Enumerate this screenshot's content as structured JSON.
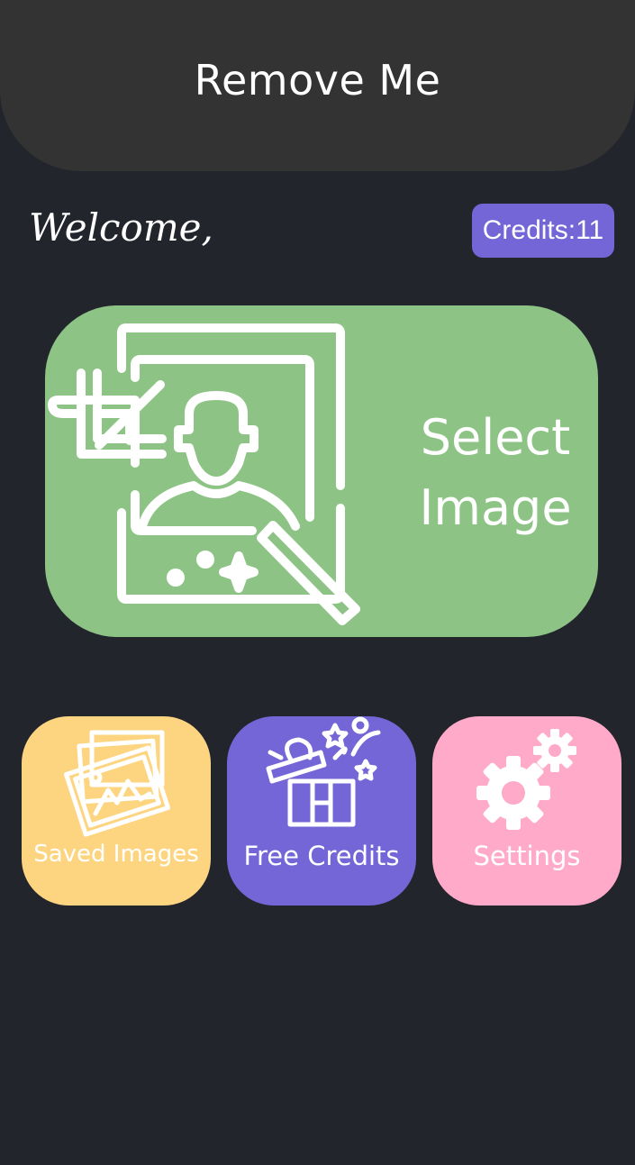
{
  "header": {
    "title": "Remove Me"
  },
  "welcome": {
    "text": "Welcome,"
  },
  "credits": {
    "label": "Credits:11"
  },
  "select_card": {
    "line1": "Select",
    "line2": "Image",
    "icon": "photo-edit-icon"
  },
  "tiles": [
    {
      "label": "Saved Images",
      "icon": "images-icon"
    },
    {
      "label": "Free Credits",
      "icon": "gift-icon"
    },
    {
      "label": "Settings",
      "icon": "gears-icon"
    }
  ],
  "colors": {
    "background": "#23252d",
    "header": "#333333",
    "accent_purple": "#7466d6",
    "green": "#8dc385",
    "yellow": "#fdd580",
    "pink": "#ffaac8"
  }
}
